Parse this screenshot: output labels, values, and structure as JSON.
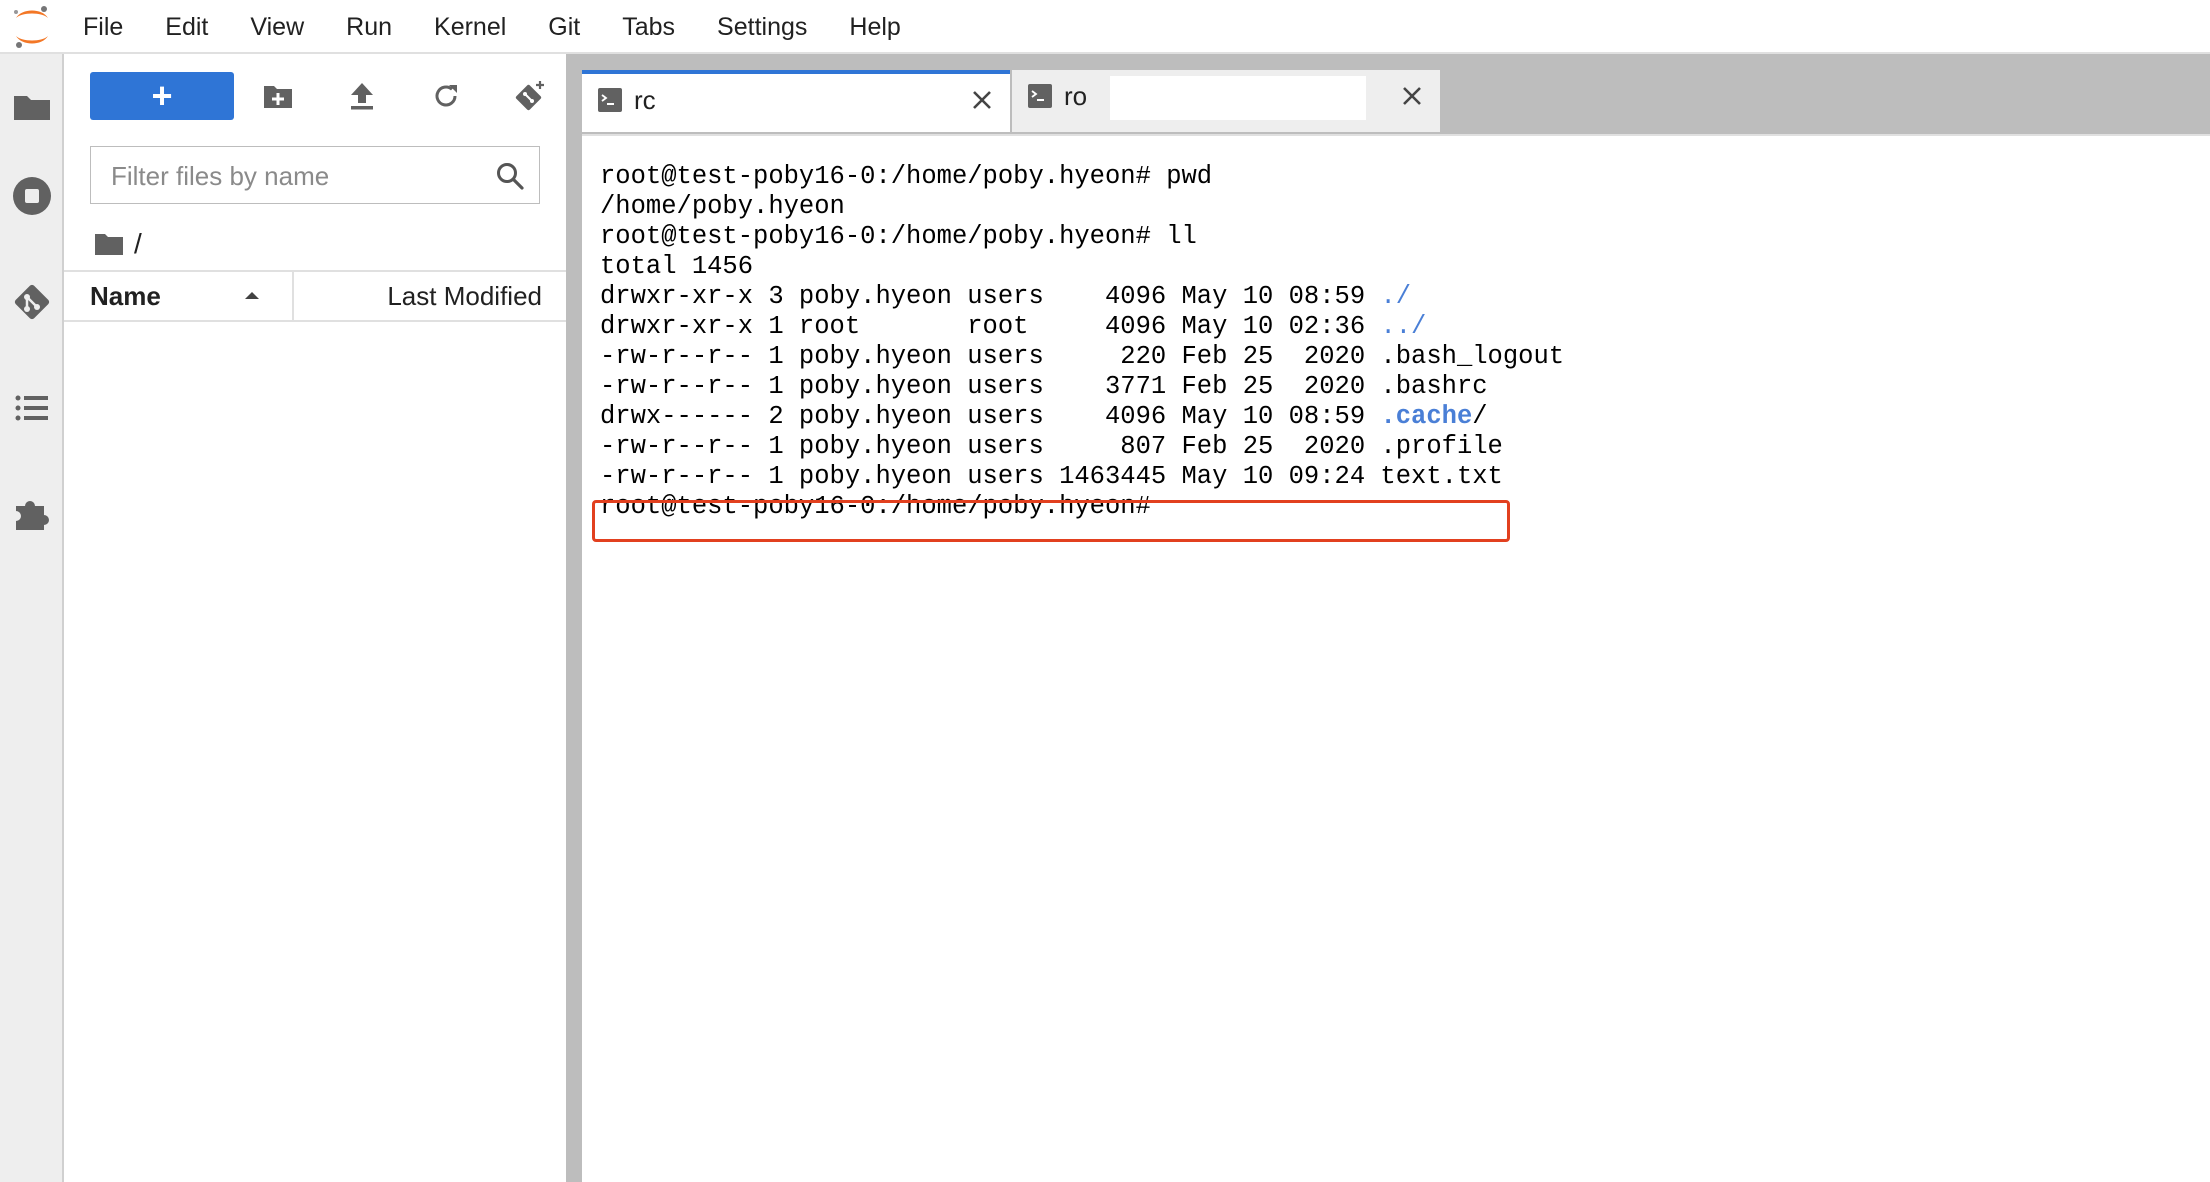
{
  "menubar": {
    "items": [
      "File",
      "Edit",
      "View",
      "Run",
      "Kernel",
      "Git",
      "Tabs",
      "Settings",
      "Help"
    ]
  },
  "activity": {
    "icons": [
      "folder-icon",
      "running-icon",
      "git-icon",
      "toc-icon",
      "extension-icon"
    ]
  },
  "filebrowser": {
    "new_label": "+",
    "filter_placeholder": "Filter files by name",
    "breadcrumb": "/",
    "columns": {
      "name": "Name",
      "modified": "Last Modified"
    }
  },
  "tabs": [
    {
      "label": "rc",
      "active": true
    },
    {
      "label": "ro",
      "active": false
    }
  ],
  "terminal": {
    "lines": [
      "root@test-poby16-0:/home/poby.hyeon# pwd",
      "/home/poby.hyeon",
      "root@test-poby16-0:/home/poby.hyeon# ll",
      "total 1456",
      "drwxr-xr-x 3 poby.hyeon users    4096 May 10 08:59 ",
      "drwxr-xr-x 1 root       root     4096 May 10 02:36 ",
      "-rw-r--r-- 1 poby.hyeon users     220 Feb 25  2020 .bash_logout",
      "-rw-r--r-- 1 poby.hyeon users    3771 Feb 25  2020 .bashrc",
      "drwx------ 2 poby.hyeon users    4096 May 10 08:59 ",
      "-rw-r--r-- 1 poby.hyeon users     807 Feb 25  2020 .profile",
      "-rw-r--r-- 1 poby.hyeon users 1463445 May 10 09:24 text.txt",
      "root@test-poby16-0:/home/poby.hyeon# "
    ],
    "dir_parts": {
      "line4": "./",
      "line5": "../",
      "line8_dir": ".cache",
      "line8_slash": "/"
    }
  },
  "colors": {
    "accent": "#2f75d6",
    "highlight": "#e2401f",
    "dir_text": "#4a7fd6"
  }
}
